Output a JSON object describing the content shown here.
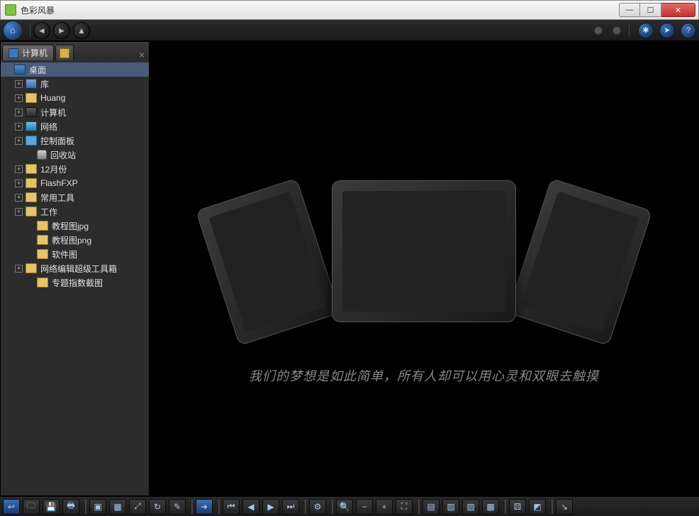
{
  "window": {
    "title": "色彩风暴"
  },
  "tabs": {
    "active_label": "计算机"
  },
  "tree": [
    {
      "indent": 0,
      "exp": "",
      "icon": "desktop",
      "label": "桌面"
    },
    {
      "indent": 1,
      "exp": "+",
      "icon": "lib",
      "label": "库"
    },
    {
      "indent": 1,
      "exp": "+",
      "icon": "folder",
      "label": "Huang"
    },
    {
      "indent": 1,
      "exp": "+",
      "icon": "computer",
      "label": "计算机"
    },
    {
      "indent": 1,
      "exp": "+",
      "icon": "network",
      "label": "网络"
    },
    {
      "indent": 1,
      "exp": "+",
      "icon": "panel",
      "label": "控制面板"
    },
    {
      "indent": 2,
      "exp": "",
      "icon": "recycle",
      "label": "回收站"
    },
    {
      "indent": 1,
      "exp": "+",
      "icon": "folder",
      "label": "12月份"
    },
    {
      "indent": 1,
      "exp": "+",
      "icon": "folder",
      "label": "FlashFXP"
    },
    {
      "indent": 1,
      "exp": "+",
      "icon": "folder",
      "label": "常用工具"
    },
    {
      "indent": 1,
      "exp": "+",
      "icon": "folder",
      "label": "工作"
    },
    {
      "indent": 2,
      "exp": "",
      "icon": "folder",
      "label": "教程图jpg"
    },
    {
      "indent": 2,
      "exp": "",
      "icon": "folder",
      "label": "教程图png"
    },
    {
      "indent": 2,
      "exp": "",
      "icon": "folder",
      "label": "软件图"
    },
    {
      "indent": 1,
      "exp": "+",
      "icon": "folder",
      "label": "网络编辑超级工具箱"
    },
    {
      "indent": 2,
      "exp": "",
      "icon": "folder",
      "label": "专题指数截图"
    }
  ],
  "caption": "我们的梦想是如此简单，所有人却可以用心灵和双眼去触摸",
  "bottom_actions": [
    "back",
    "open",
    "save",
    "print",
    "sep",
    "layout-large",
    "layout-small",
    "stretch",
    "rotate",
    "edit",
    "sep",
    "forward",
    "sep",
    "first",
    "prev",
    "next",
    "last",
    "sep",
    "settings",
    "sep",
    "zoom-actual",
    "zoom-out",
    "zoom-in",
    "zoom-fit",
    "sep",
    "grid",
    "thumb1",
    "thumb2",
    "thumb3",
    "sep",
    "random",
    "snap",
    "sep",
    "full"
  ]
}
